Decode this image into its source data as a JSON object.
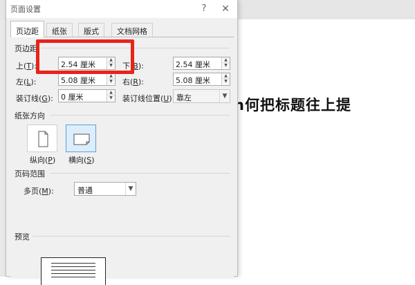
{
  "dialog": {
    "title": "页面设置",
    "help": "?",
    "close": "✕"
  },
  "tabs": [
    {
      "label": "页边距",
      "active": true
    },
    {
      "label": "纸张",
      "active": false
    },
    {
      "label": "版式",
      "active": false
    },
    {
      "label": "文档网格",
      "active": false
    }
  ],
  "margins": {
    "section": "页边距",
    "top": {
      "label": "上(",
      "key": "T",
      "suffix": "):",
      "value": "2.54 厘米"
    },
    "bottom": {
      "label": "下(",
      "key": "B",
      "suffix": "):",
      "value": "2.54 厘米"
    },
    "left": {
      "label": "左(",
      "key": "L",
      "suffix": "):",
      "value": "5.08 厘米"
    },
    "right": {
      "label": "右(",
      "key": "R",
      "suffix": "):",
      "value": "5.08 厘米"
    },
    "gutter": {
      "label": "装订线(",
      "key": "G",
      "suffix": "):",
      "value": "0 厘米"
    },
    "gutter_pos": {
      "label": "装订线位置(",
      "key": "U",
      "suffix": "):",
      "value": "靠左"
    }
  },
  "orientation": {
    "section": "纸张方向",
    "portrait": {
      "label": "纵向(",
      "key": "P",
      "suffix": ")"
    },
    "landscape": {
      "label": "横向(",
      "key": "S",
      "suffix": ")",
      "selected": true
    }
  },
  "pages": {
    "section": "页码范围",
    "multi": {
      "label": "多页(",
      "key": "M",
      "suffix": "):",
      "value": "普通"
    }
  },
  "preview": {
    "section": "预览"
  },
  "document": {
    "heading": "n何把标题往上提"
  },
  "colors": {
    "highlight": "#e8231a",
    "selected_bg": "#dceefc",
    "selected_border": "#5aa0dd"
  }
}
